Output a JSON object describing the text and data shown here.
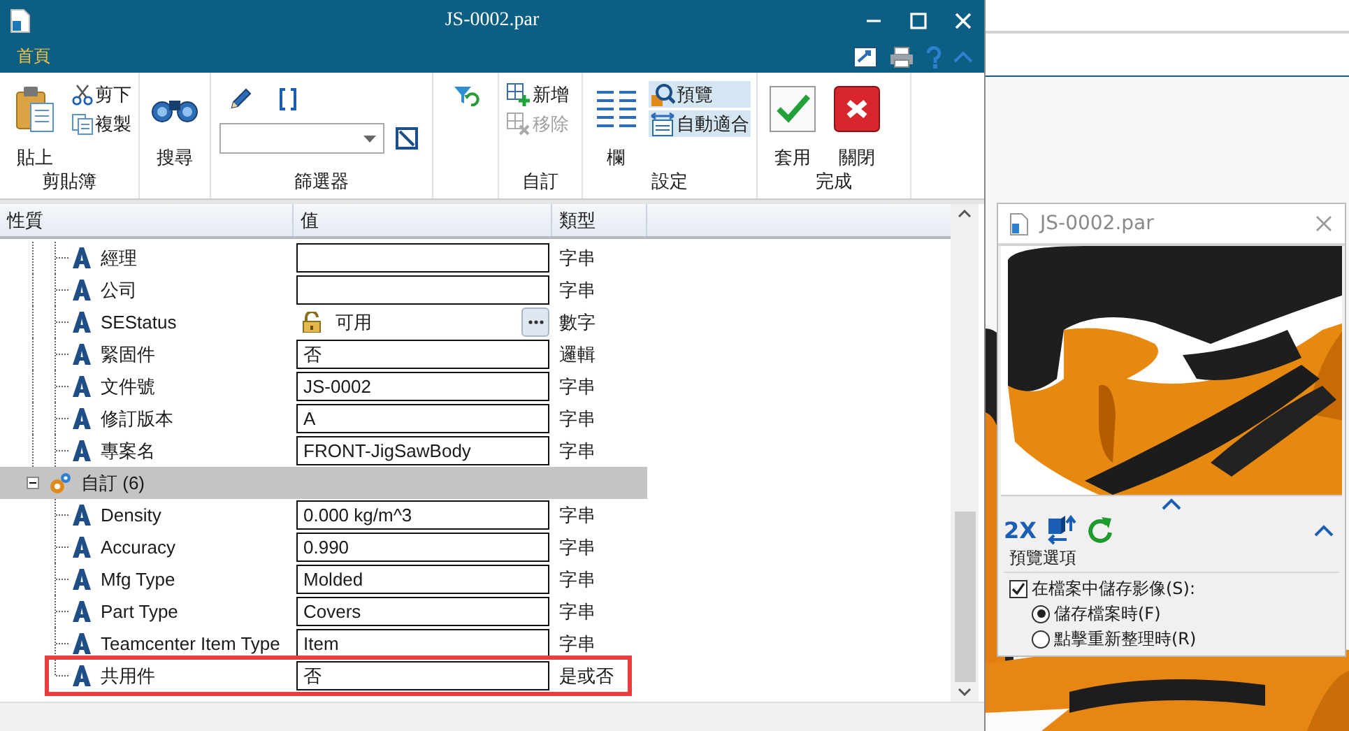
{
  "window": {
    "title": "JS-0002.par"
  },
  "ribbon": {
    "tabs": [
      {
        "label": "首頁",
        "selected": true
      }
    ],
    "groups": [
      {
        "label": "剪貼簿",
        "columns": [
          {
            "kind": "large",
            "label": "貼上"
          },
          {
            "kind": "stack",
            "buttons": [
              {
                "label": "剪下",
                "disabled": false,
                "selected": false
              },
              {
                "label": "複製",
                "disabled": false,
                "selected": false
              }
            ]
          }
        ]
      },
      {
        "columns": [
          {
            "kind": "large",
            "label": "搜尋"
          }
        ]
      },
      {
        "label": "篩選器",
        "columns": [
          {
            "kind": "filter"
          }
        ]
      },
      {
        "columns": [
          {
            "kind": "icon"
          }
        ]
      },
      {
        "label": "自訂",
        "columns": [
          {
            "kind": "stack",
            "buttons": [
              {
                "label": "新增",
                "disabled": false,
                "selected": false
              },
              {
                "label": "移除",
                "disabled": true,
                "selected": false
              }
            ]
          }
        ]
      },
      {
        "label": "設定",
        "columns": [
          {
            "kind": "large",
            "label": "欄"
          },
          {
            "kind": "stack",
            "buttons": [
              {
                "label": "預覽",
                "disabled": false,
                "selected": true
              },
              {
                "label": "自動適合",
                "disabled": false,
                "selected": true
              }
            ]
          }
        ]
      },
      {
        "label": "完成",
        "columns": [
          {
            "kind": "large",
            "label": "套用"
          },
          {
            "kind": "large",
            "label": "關閉"
          }
        ]
      }
    ]
  },
  "table": {
    "columns": [
      "性質",
      "值",
      "類型"
    ],
    "rows": [
      {
        "kind": "text",
        "name": "經理",
        "type": "字串",
        "highlighted": false
      },
      {
        "kind": "text",
        "name": "公司",
        "type": "字串",
        "highlighted": false
      },
      {
        "kind": "status",
        "name": "SEStatus",
        "value": "可用",
        "type": "數字",
        "highlighted": false
      },
      {
        "kind": "text",
        "name": "緊固件",
        "value": "否",
        "type": "邏輯",
        "highlighted": false
      },
      {
        "kind": "text",
        "name": "文件號",
        "value": "JS-0002",
        "type": "字串",
        "highlighted": false
      },
      {
        "kind": "text",
        "name": "修訂版本",
        "value": "A",
        "type": "字串",
        "highlighted": false
      },
      {
        "kind": "text",
        "name": "專案名",
        "value": "FRONT-JigSawBody",
        "type": "字串",
        "highlighted": false
      },
      {
        "kind": "group",
        "name": "自訂 (6)",
        "expanded": true,
        "children": [
          {
            "kind": "text",
            "name": "Density",
            "value": "0.000 kg/m^3",
            "type": "字串",
            "highlighted": false
          },
          {
            "kind": "text",
            "name": "Accuracy",
            "value": "0.990",
            "type": "字串",
            "highlighted": false
          },
          {
            "kind": "text",
            "name": "Mfg Type",
            "value": "Molded",
            "type": "字串",
            "highlighted": false
          },
          {
            "kind": "text",
            "name": "Part Type",
            "value": "Covers",
            "type": "字串",
            "highlighted": false
          },
          {
            "kind": "text",
            "name": "Teamcenter Item Type",
            "value": "Item",
            "type": "字串",
            "highlighted": false
          },
          {
            "kind": "text",
            "name": "共用件",
            "value": "否",
            "type": "是或否",
            "highlighted": true
          }
        ]
      }
    ]
  },
  "preview": {
    "title": "JS-0002.par",
    "zoom_label": "2X",
    "options": {
      "legend": "預覽選項",
      "save_image": {
        "label": "在檔案中儲存影像(S):",
        "checked": true
      },
      "modes": [
        {
          "label": "儲存檔案時(F)",
          "selected": true
        },
        {
          "label": "點擊重新整理時(R)",
          "selected": false
        }
      ]
    }
  }
}
